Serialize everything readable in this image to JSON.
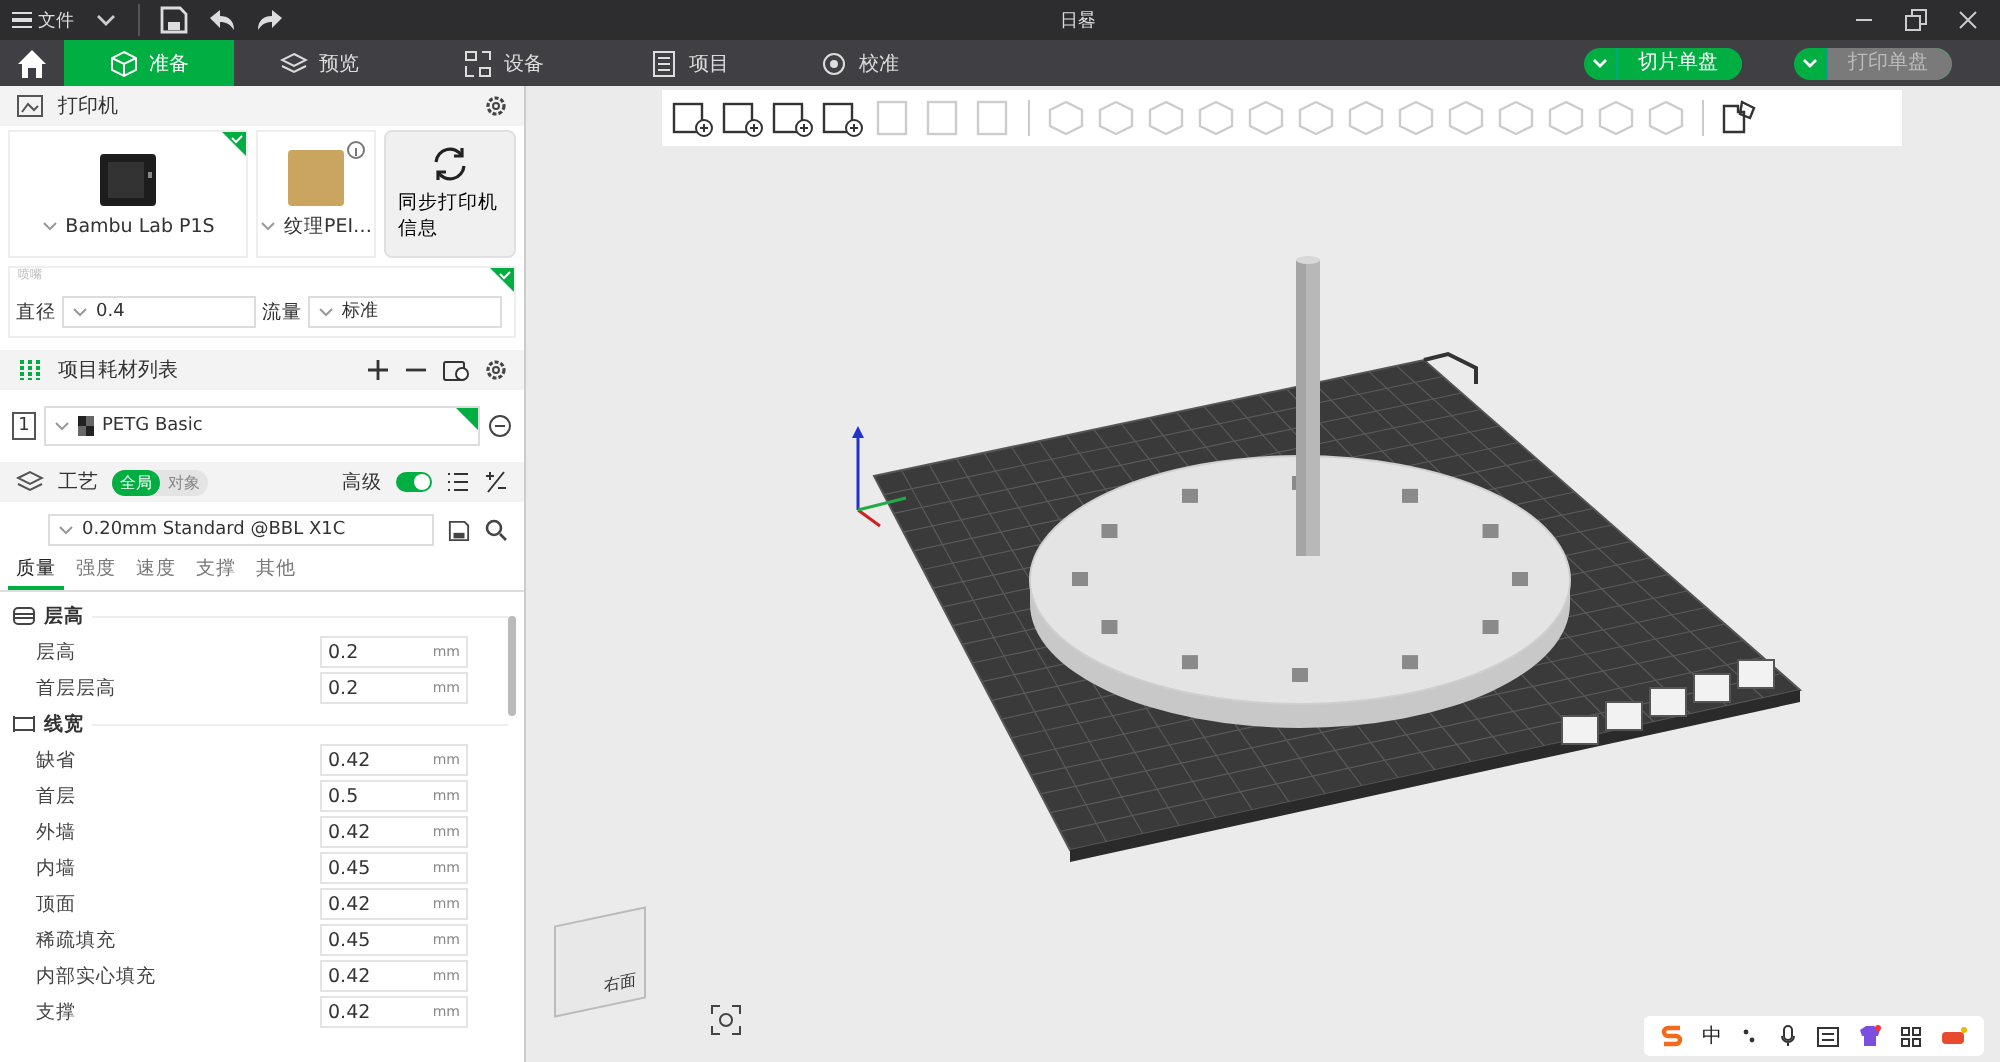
{
  "window": {
    "menu": "文件",
    "title": "日晷"
  },
  "tabs": [
    {
      "label": "准备",
      "kind": "prepare",
      "selected": true
    },
    {
      "label": "预览",
      "kind": "preview",
      "selected": false
    },
    {
      "label": "设备",
      "kind": "device",
      "selected": false
    },
    {
      "label": "项目",
      "kind": "project",
      "selected": false
    },
    {
      "label": "校准",
      "kind": "calibrate",
      "selected": false
    }
  ],
  "actions": [
    {
      "label": "切片单盘",
      "disabled": false
    },
    {
      "label": "打印单盘",
      "disabled": true
    }
  ],
  "printer": {
    "title": "打印机",
    "model": "Bambu Lab P1S",
    "plate": "纹理PEI…",
    "sync": "同步打印机信息",
    "nozzle_label": "喷嘴",
    "diameter_label": "直径",
    "diameter": "0.4",
    "flow_label": "流量",
    "flow": "标准"
  },
  "filaments": {
    "title": "项目耗材列表",
    "items": [
      {
        "index": "1",
        "name": "PETG Basic"
      }
    ]
  },
  "process": {
    "title": "工艺",
    "scopes": [
      {
        "label": "全局",
        "selected": true
      },
      {
        "label": "对象",
        "selected": false
      }
    ],
    "advanced_label": "高级",
    "advanced": true,
    "preset": "0.20mm Standard @BBL X1C",
    "tabs": [
      {
        "label": "质量",
        "selected": true
      },
      {
        "label": "强度",
        "selected": false
      },
      {
        "label": "速度",
        "selected": false
      },
      {
        "label": "支撑",
        "selected": false
      },
      {
        "label": "其他",
        "selected": false
      }
    ],
    "groups": [
      {
        "title": "层高",
        "kind": "layer",
        "rows": [
          {
            "label": "层高",
            "value": "0.2",
            "unit": "mm"
          },
          {
            "label": "首层层高",
            "value": "0.2",
            "unit": "mm"
          }
        ]
      },
      {
        "title": "线宽",
        "kind": "width",
        "rows": [
          {
            "label": "缺省",
            "value": "0.42",
            "unit": "mm"
          },
          {
            "label": "首层",
            "value": "0.5",
            "unit": "mm"
          },
          {
            "label": "外墙",
            "value": "0.42",
            "unit": "mm"
          },
          {
            "label": "内墙",
            "value": "0.45",
            "unit": "mm"
          },
          {
            "label": "顶面",
            "value": "0.42",
            "unit": "mm"
          },
          {
            "label": "稀疏填充",
            "value": "0.45",
            "unit": "mm"
          },
          {
            "label": "内部实心填充",
            "value": "0.42",
            "unit": "mm"
          },
          {
            "label": "支撑",
            "value": "0.42",
            "unit": "mm"
          }
        ]
      }
    ]
  },
  "viewport": {
    "cube_label": "右面"
  },
  "taskbar": {
    "ime": "中"
  }
}
